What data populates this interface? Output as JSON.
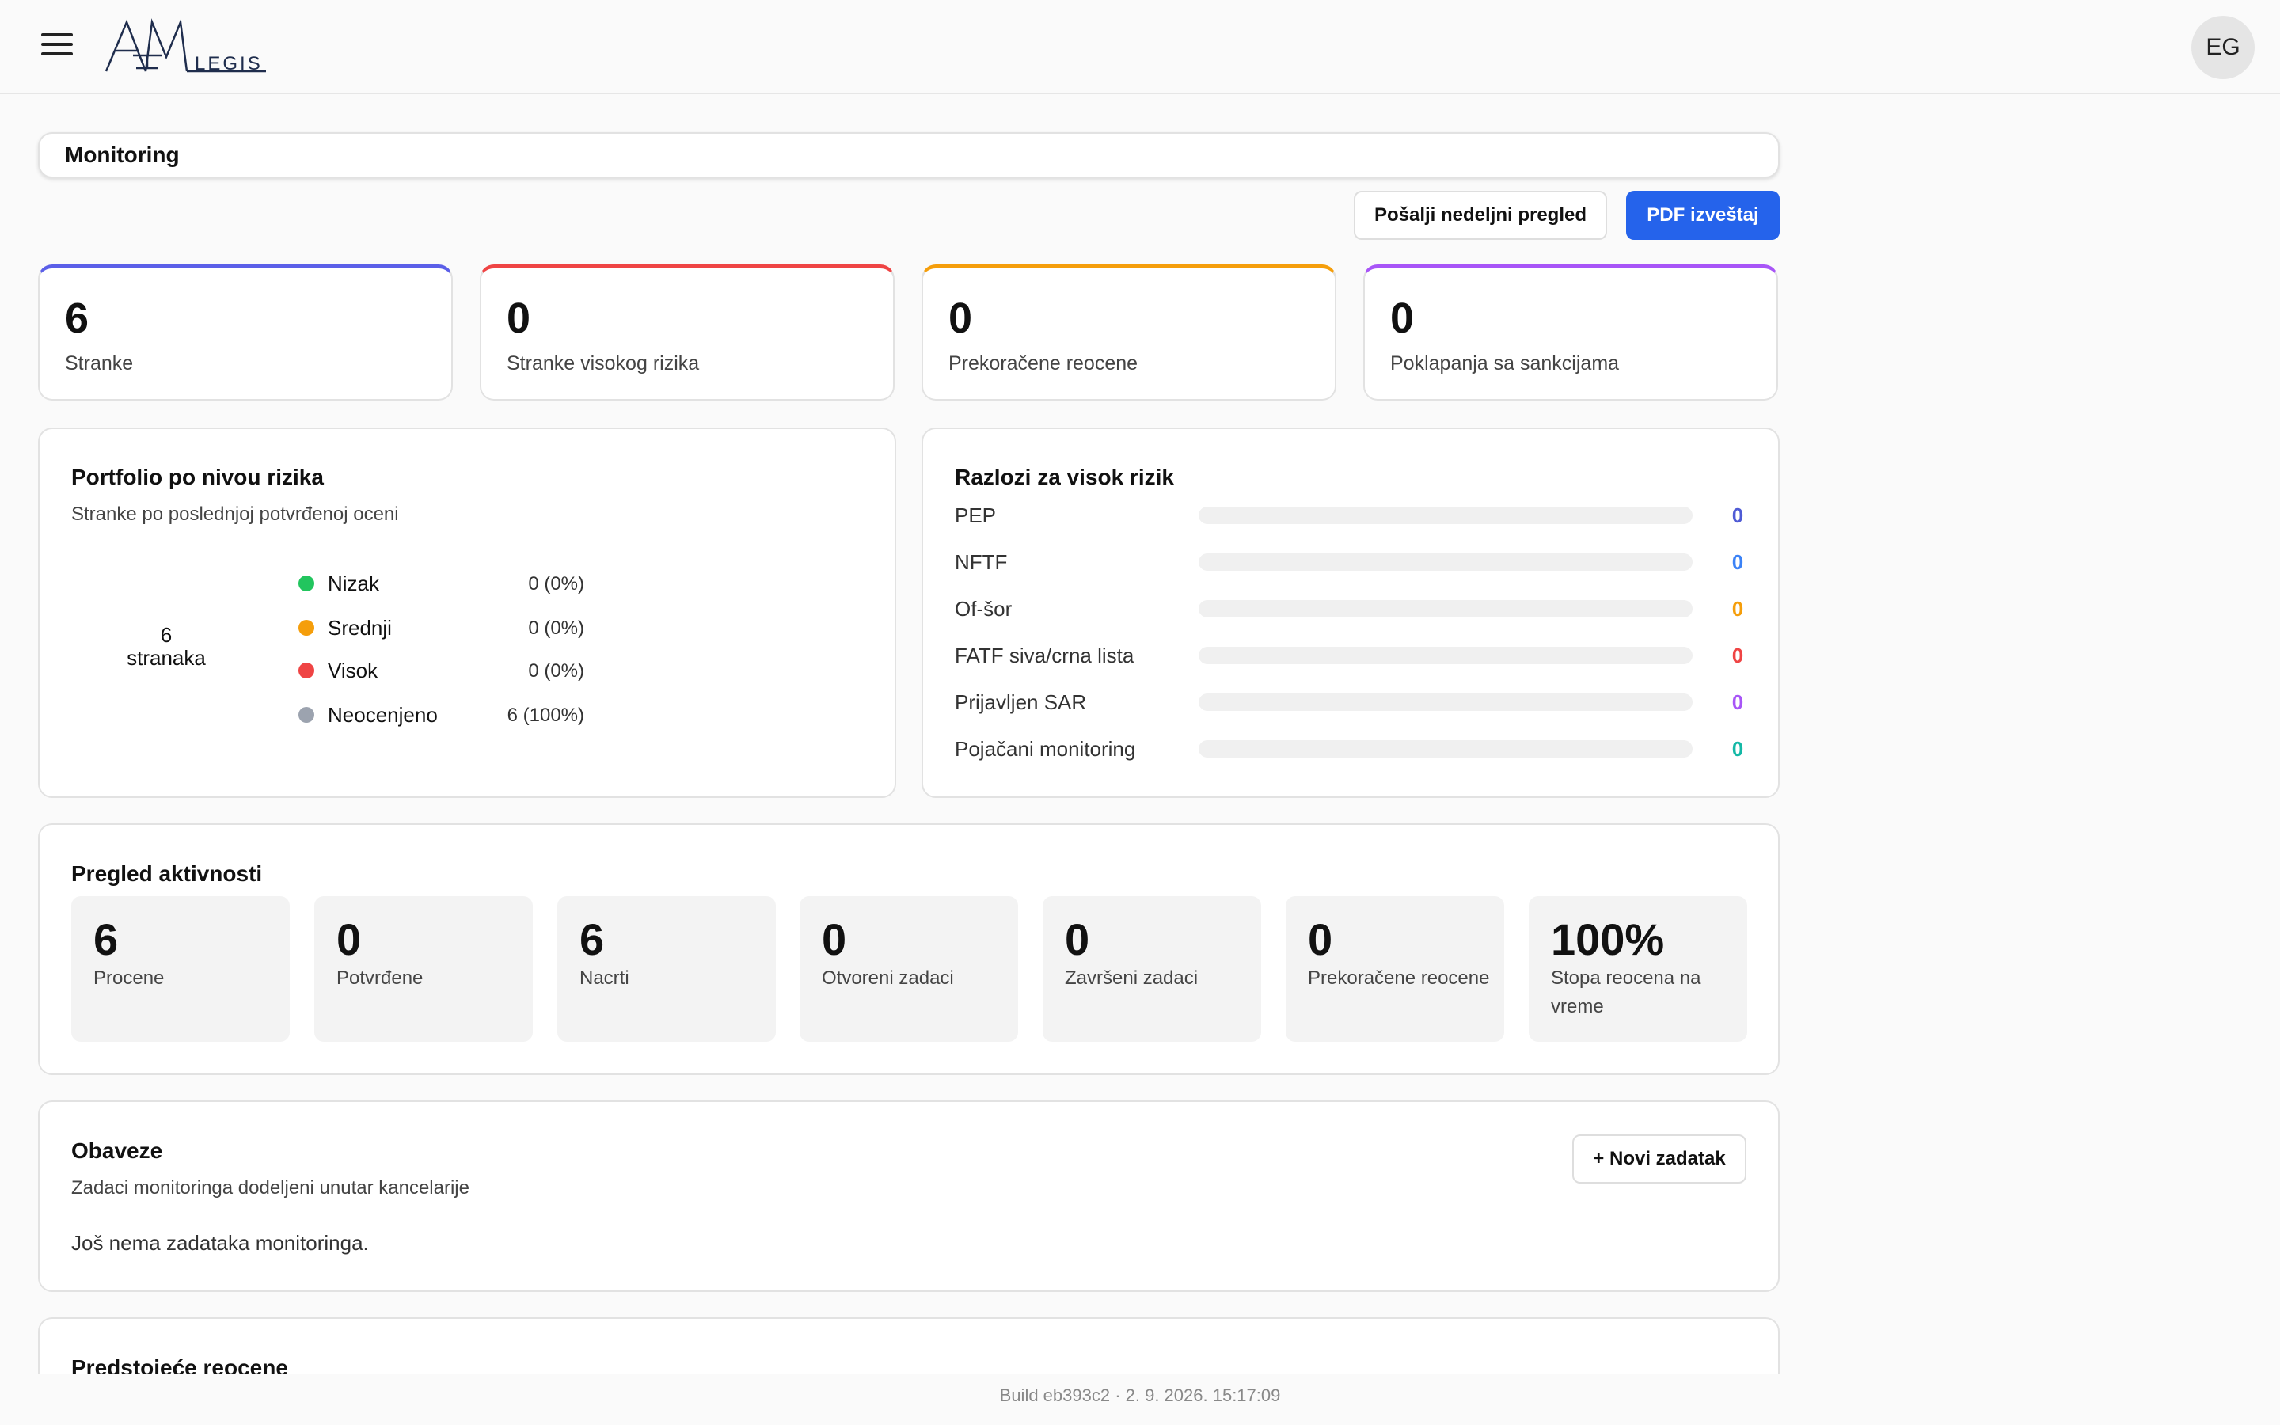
{
  "header": {
    "logo_text": "AML LEGIS",
    "avatar_initials": "EG"
  },
  "page": {
    "title": "Monitoring"
  },
  "actions": {
    "weekly_label": "Pošalji nedeljni pregled",
    "pdf_label": "PDF izveštaj"
  },
  "kpis": [
    {
      "value": "6",
      "label": "Stranke",
      "color": "#5b5fe8"
    },
    {
      "value": "0",
      "label": "Stranke visokog rizika",
      "color": "#ef4444"
    },
    {
      "value": "0",
      "label": "Prekoračene reocene",
      "color": "#f59e0b"
    },
    {
      "value": "0",
      "label": "Poklapanja sa sankcijama",
      "color": "#a855f7"
    }
  ],
  "portfolio": {
    "title": "Portfolio po nivou rizika",
    "subtitle": "Stranke po poslednjoj potvrđenoj oceni",
    "center_count": "6",
    "center_unit": "stranaka",
    "legend": [
      {
        "label": "Nizak",
        "value": "0 (0%)",
        "color": "#22c55e"
      },
      {
        "label": "Srednji",
        "value": "0 (0%)",
        "color": "#f59e0b"
      },
      {
        "label": "Visok",
        "value": "0 (0%)",
        "color": "#ef4444"
      },
      {
        "label": "Neocenjeno",
        "value": "6 (100%)",
        "color": "#9ca3af"
      }
    ]
  },
  "reasons": {
    "title": "Razlozi za visok rizik",
    "items": [
      {
        "label": "PEP",
        "value": "0",
        "color": "#4f5bd5"
      },
      {
        "label": "NFTF",
        "value": "0",
        "color": "#3b82f6"
      },
      {
        "label": "Of-šor",
        "value": "0",
        "color": "#f59e0b"
      },
      {
        "label": "FATF siva/crna lista",
        "value": "0",
        "color": "#ef4444"
      },
      {
        "label": "Prijavljen SAR",
        "value": "0",
        "color": "#a855f7"
      },
      {
        "label": "Pojačani monitoring",
        "value": "0",
        "color": "#14b8a6"
      }
    ]
  },
  "activity": {
    "title": "Pregled aktivnosti",
    "items": [
      {
        "value": "6",
        "label": "Procene"
      },
      {
        "value": "0",
        "label": "Potvrđene"
      },
      {
        "value": "6",
        "label": "Nacrti"
      },
      {
        "value": "0",
        "label": "Otvoreni zadaci"
      },
      {
        "value": "0",
        "label": "Završeni zadaci"
      },
      {
        "value": "0",
        "label": "Prekoračene reocene"
      },
      {
        "value": "100%",
        "label": "Stopa reocena na vreme"
      }
    ]
  },
  "obligations": {
    "title": "Obaveze",
    "subtitle": "Zadaci monitoringa dodeljeni unutar kancelarije",
    "new_task_label": "+ Novi zadatak",
    "empty_text": "Još nema zadataka monitoringa."
  },
  "upcoming": {
    "title": "Predstojeće reocene"
  },
  "footer": {
    "build_text": "Build eb393c2 · 2. 9. 2026. 15:17:09"
  }
}
